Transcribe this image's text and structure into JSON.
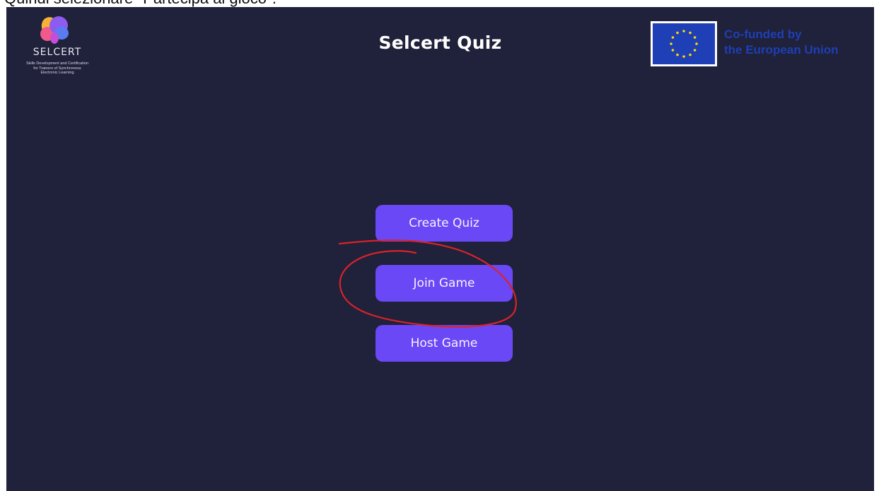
{
  "caption": "Quindi selezionare \"Partecipa al gioco\".",
  "logo": {
    "name": "SELCERT",
    "tagline": [
      "Skills Development and Certification",
      "for Trainers of Synchronous",
      "Electronic Learning"
    ]
  },
  "header": {
    "title": "Selcert Quiz"
  },
  "eu_badge": {
    "line1": "Co-funded by",
    "line2": "the European Union"
  },
  "menu": {
    "create_label": "Create Quiz",
    "join_label": "Join Game",
    "host_label": "Host Game"
  },
  "colors": {
    "background": "#20213a",
    "button": "#6b48f6",
    "eu_blue": "#1e3fb5",
    "annotation": "#d8232a"
  },
  "icons": [
    "selcert-brain-logo-icon",
    "eu-flag-icon"
  ]
}
